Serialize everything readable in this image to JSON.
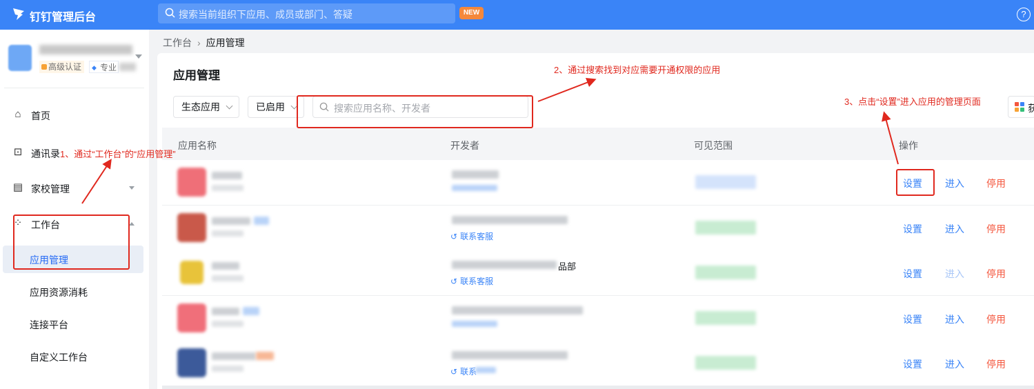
{
  "header": {
    "app_title": "钉钉管理后台",
    "search_placeholder": "搜索当前组织下应用、成员或部门、答疑",
    "new_badge": "NEW",
    "help_icon": "?"
  },
  "sidebar": {
    "cert_label": "高级认证",
    "pro_label": "专业",
    "items": [
      {
        "label": "首页",
        "icon": "home-icon"
      },
      {
        "label": "通讯录",
        "icon": "contacts-icon"
      },
      {
        "label": "家校管理",
        "icon": "school-icon"
      },
      {
        "label": "工作台",
        "icon": "workbench-icon"
      }
    ],
    "sub_items": [
      {
        "label": "应用管理",
        "active": true
      },
      {
        "label": "应用资源消耗"
      },
      {
        "label": "连接平台"
      },
      {
        "label": "自定义工作台"
      }
    ]
  },
  "breadcrumb": {
    "root": "工作台",
    "current": "应用管理"
  },
  "page": {
    "title": "应用管理",
    "filter_type": "生态应用",
    "filter_status": "已启用",
    "search_placeholder": "搜索应用名称、开发者",
    "right_button_partial": "获"
  },
  "table": {
    "columns": [
      "应用名称",
      "开发者",
      "可见范围",
      "操作"
    ],
    "rows": [
      {
        "dev_suffix": "",
        "customer_service": "",
        "actions": [
          "设置",
          "进入",
          "停用"
        ],
        "enter_enabled": true
      },
      {
        "dev_suffix": "",
        "customer_service": "联系客服",
        "actions": [
          "设置",
          "进入",
          "停用"
        ],
        "enter_enabled": true
      },
      {
        "dev_suffix": "品部",
        "customer_service": "联系客服",
        "actions": [
          "设置",
          "进入",
          "停用"
        ],
        "enter_enabled": false
      },
      {
        "dev_suffix": "",
        "customer_service": "",
        "actions": [
          "设置",
          "进入",
          "停用"
        ],
        "enter_enabled": true
      },
      {
        "dev_suffix": "",
        "customer_service": "联系",
        "actions": [
          "设置",
          "进入",
          "停用"
        ],
        "enter_enabled": true
      }
    ]
  },
  "annotations": {
    "step1": "1、通过“工作台”的“应用管理”",
    "step2": "2、通过搜索找到对应需要开通权限的应用",
    "step3": "3、点击“设置”进入应用的管理页面"
  },
  "colors": {
    "brand": "#3a84f7",
    "danger": "#f4563d",
    "annotation": "#e0281e"
  }
}
